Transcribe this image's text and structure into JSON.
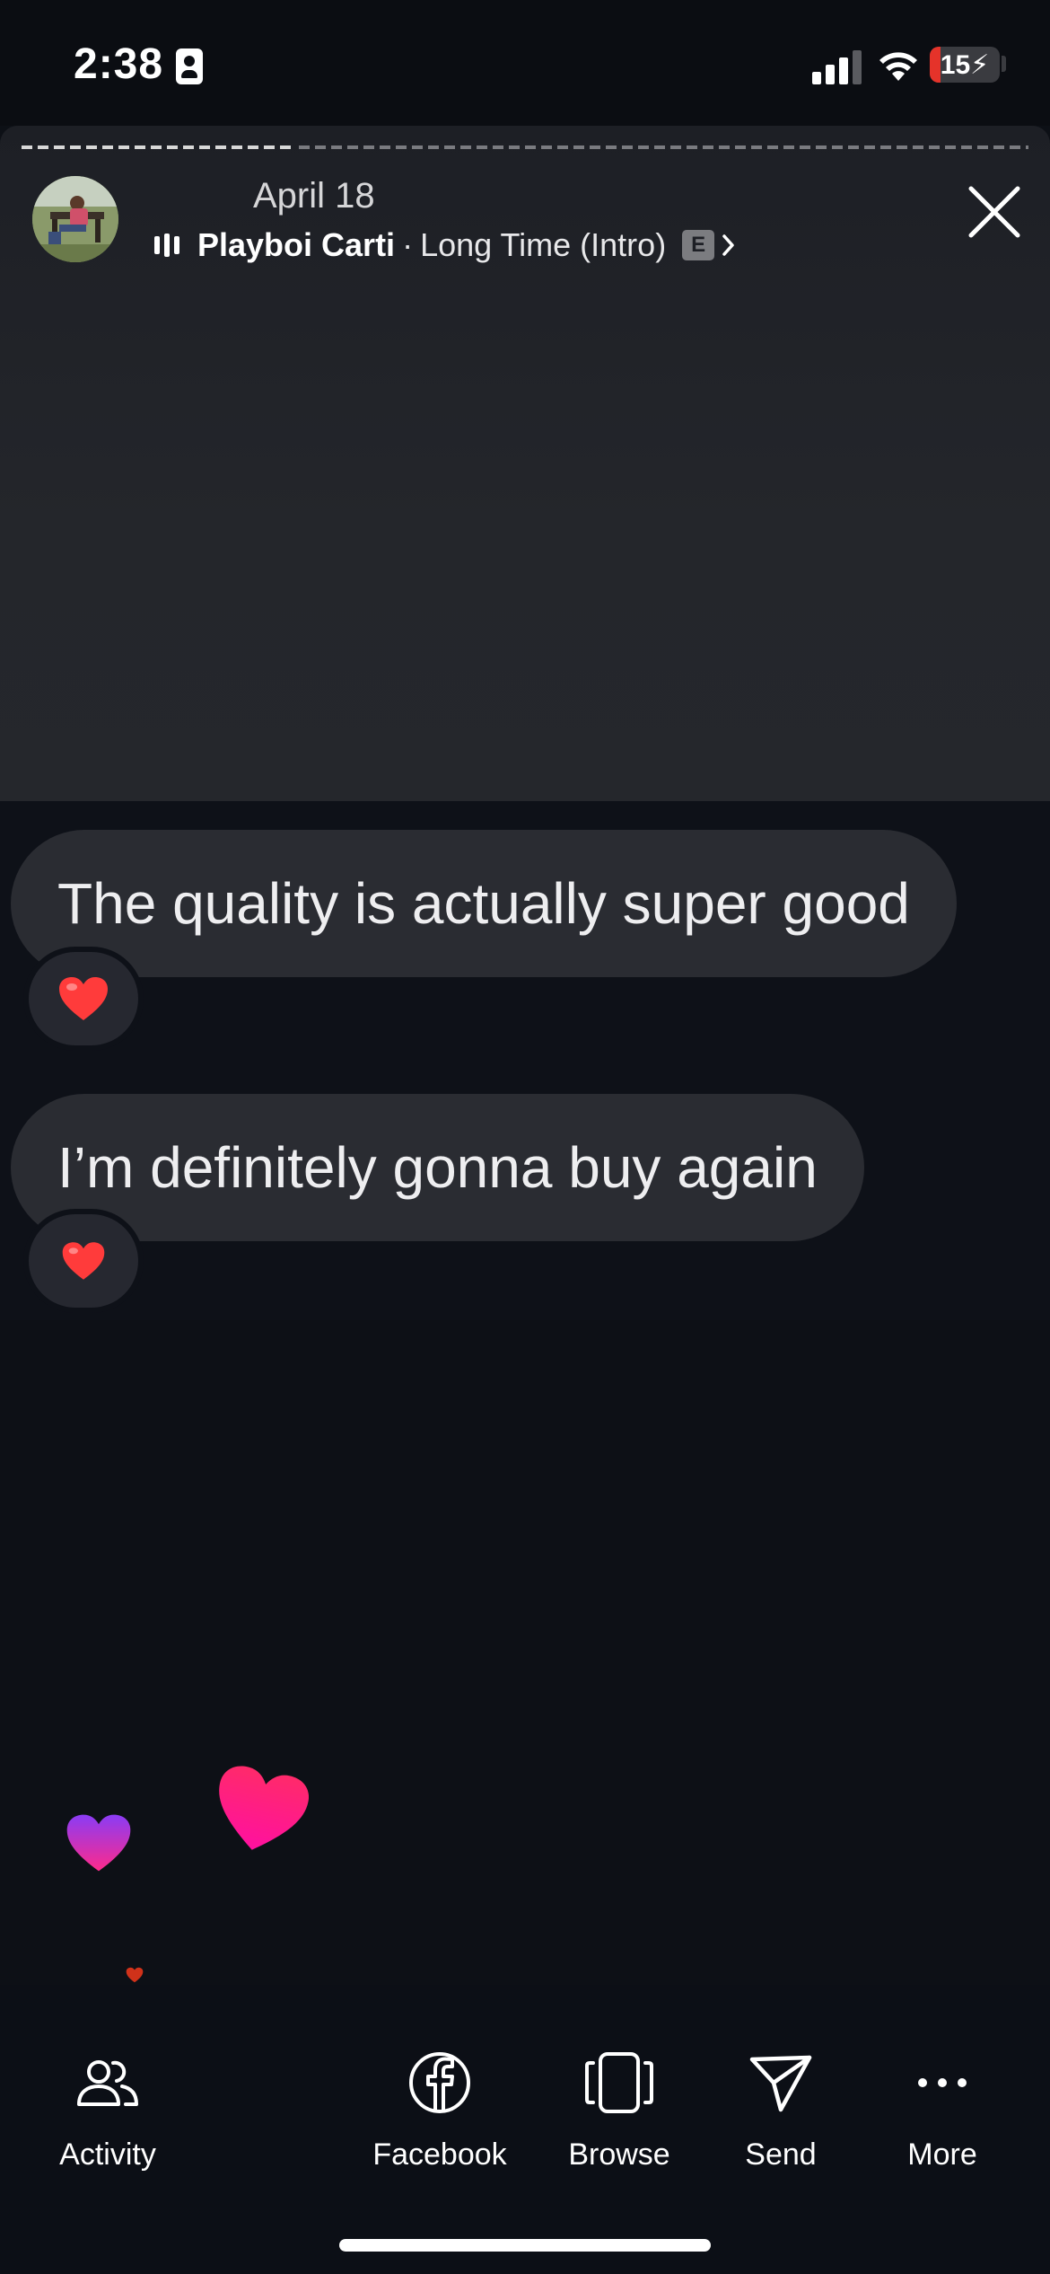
{
  "status_bar": {
    "time": "2:38",
    "battery_label": "15",
    "battery_level_percent": 15,
    "battery_color": "#e5332a"
  },
  "story": {
    "progress_fraction": 0.27,
    "date": "April 18",
    "music": {
      "artist": "Playboi Carti",
      "separator": "·",
      "song": "Long Time (Intro)",
      "explicit_badge": "E"
    }
  },
  "messages": [
    {
      "text": "The quality is actually super good",
      "reaction": "heart-emoji"
    },
    {
      "text": "I’m definitely gonna buy again",
      "reaction": "heart-emoji"
    }
  ],
  "bottom_nav": [
    {
      "label": "Activity",
      "icon": "people-icon"
    },
    {
      "label": "Facebook",
      "icon": "facebook-icon"
    },
    {
      "label": "Browse",
      "icon": "browse-icon"
    },
    {
      "label": "Send",
      "icon": "send-icon"
    },
    {
      "label": "More",
      "icon": "more-icon"
    }
  ],
  "colors": {
    "background": "#0d1016",
    "bubble": "#2a2c32",
    "heart_pink": "#ff1f7a",
    "heart_purple": "#b03cf0"
  }
}
